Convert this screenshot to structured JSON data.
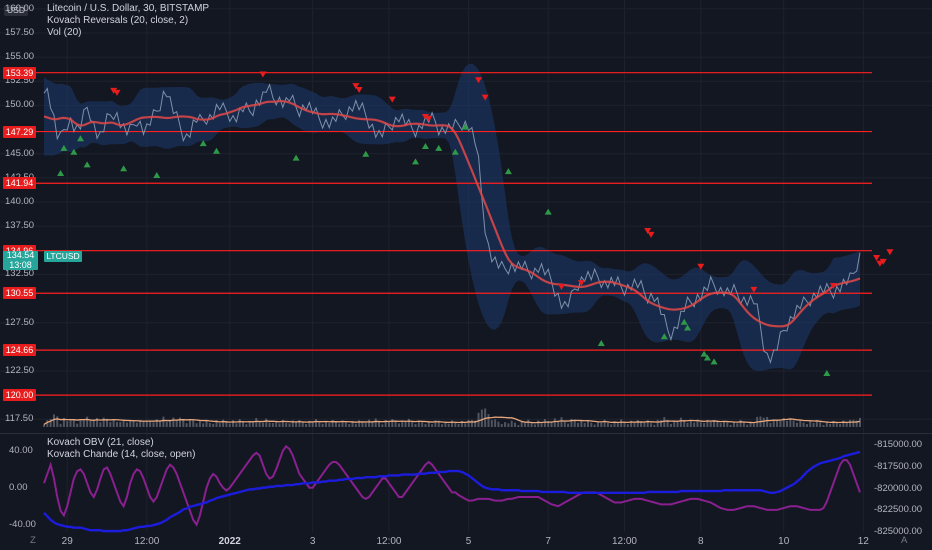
{
  "legend": {
    "main_title": "Litecoin / U.S. Dollar, 30, BITSTAMP",
    "indicator_kovach": "Kovach Reversals (20, close, 2)",
    "indicator_vol": "Vol (20)",
    "osc_obv": "Kovach OBV (21, close)",
    "osc_chande": "Kovach Chande (14, close, open)"
  },
  "currency_badge": "USD",
  "symbol_badge": "LTCUSD",
  "current_price": {
    "price": "134.54",
    "countdown": "13:08"
  },
  "price_tags": [
    {
      "label": "153.39",
      "value": 153.39
    },
    {
      "label": "147.29",
      "value": 147.29
    },
    {
      "label": "141.94",
      "value": 141.94
    },
    {
      "label": "134.96",
      "value": 134.96
    },
    {
      "label": "130.55",
      "value": 130.55
    },
    {
      "label": "124.66",
      "value": 124.66
    },
    {
      "label": "120.00",
      "value": 120.0
    }
  ],
  "price_axis_labels": [
    {
      "label": "160.00",
      "value": 160.0
    },
    {
      "label": "157.50",
      "value": 157.5
    },
    {
      "label": "155.00",
      "value": 155.0
    },
    {
      "label": "152.50",
      "value": 152.5
    },
    {
      "label": "150.00",
      "value": 150.0
    },
    {
      "label": "145.00",
      "value": 145.0
    },
    {
      "label": "142.50",
      "value": 142.5
    },
    {
      "label": "140.00",
      "value": 140.0
    },
    {
      "label": "137.50",
      "value": 137.5
    },
    {
      "label": "132.50",
      "value": 132.5
    },
    {
      "label": "127.50",
      "value": 127.5
    },
    {
      "label": "122.50",
      "value": 122.5
    },
    {
      "label": "117.50",
      "value": 117.5
    }
  ],
  "osc_left_labels": [
    {
      "label": "40.00",
      "value": 40
    },
    {
      "label": "0.00",
      "value": 0
    },
    {
      "label": "-40.00",
      "value": -40
    }
  ],
  "osc_right_labels": [
    {
      "label": "-815000.00",
      "value": -815000
    },
    {
      "label": "-817500.00",
      "value": -817500
    },
    {
      "label": "-820000.00",
      "value": -820000
    },
    {
      "label": "-822500.00",
      "value": -822500
    },
    {
      "label": "-825000.00",
      "value": -825000
    }
  ],
  "time_labels": [
    {
      "label": "29",
      "idx": 7,
      "bold": false
    },
    {
      "label": "12:00",
      "idx": 31,
      "bold": false
    },
    {
      "label": "2022",
      "idx": 56,
      "bold": true
    },
    {
      "label": "3",
      "idx": 81,
      "bold": false
    },
    {
      "label": "12:00",
      "idx": 104,
      "bold": false
    },
    {
      "label": "5",
      "idx": 128,
      "bold": false
    },
    {
      "label": "7",
      "idx": 152,
      "bold": false
    },
    {
      "label": "12:00",
      "idx": 175,
      "bold": false
    },
    {
      "label": "8",
      "idx": 198,
      "bold": false
    },
    {
      "label": "10",
      "idx": 223,
      "bold": false
    },
    {
      "label": "12",
      "idx": 247,
      "bold": false
    }
  ],
  "corner_labels": {
    "left": "Z",
    "right": "A"
  },
  "colors": {
    "background": "#131722",
    "level_line": "#ff1f1f",
    "band_fill": "#1e3a6e",
    "ma_line": "#e04848",
    "price_line": "#7e90a8",
    "sell_marker": "#e81c1c",
    "buy_marker": "#2e9a48",
    "volume": "#6b6f7a",
    "volume_ma": "#e8a77c",
    "obv_line": "#1c1cdc",
    "chande_line": "#8a2090",
    "accent": "#26a69a"
  },
  "chart_data": {
    "type": "line",
    "series": [
      {
        "name": "LTCUSD",
        "values": [
          152,
          151.5,
          150.2,
          148.5,
          146.8,
          146.5,
          147.5,
          148.2,
          148.5,
          147.8,
          147.5,
          147.8,
          148.8,
          149.8,
          149.2,
          148,
          147.1,
          146.8,
          147.5,
          148.4,
          149,
          149.3,
          149,
          148.2,
          147.6,
          147.2,
          147.3,
          148,
          148.6,
          148.1,
          147.5,
          147.6,
          148.2,
          148.8,
          149.4,
          150.2,
          151.2,
          151.4,
          150.4,
          149.4,
          148.6,
          147.9,
          147.1,
          146.8,
          147.2,
          148,
          148.5,
          148.3,
          148.5,
          148.8,
          148.8,
          149.1,
          149.6,
          149.8,
          149.5,
          149.4,
          149.1,
          148.7,
          148.8,
          149.2,
          149.6,
          149.5,
          149.4,
          149.7,
          150.3,
          150.5,
          150.9,
          151.6,
          151.4,
          150.8,
          150.8,
          150.6,
          150.3,
          150.3,
          150.7,
          150.3,
          149.8,
          149.6,
          149.8,
          150,
          149.8,
          149.4,
          149,
          148.6,
          148.4,
          148.3,
          148.2,
          148.3,
          148.6,
          148.8,
          149,
          149.3,
          149.6,
          149.9,
          150,
          149.8,
          149.5,
          149,
          148.4,
          147.8,
          147.2,
          146.9,
          147,
          147.4,
          147.8,
          148.2,
          148.5,
          148.8,
          148.6,
          148.2,
          147.8,
          147.6,
          147.5,
          147.7,
          148.1,
          148.4,
          148.5,
          148.5,
          148.3,
          147.7,
          147.5,
          147.6,
          147.6,
          147.7,
          147.8,
          148,
          148.2,
          148.1,
          147.9,
          147.2,
          146.2,
          144,
          140.5,
          137.5,
          135.4,
          134.3,
          133.8,
          133.4,
          133.1,
          133.1,
          133.3,
          133.4,
          133.3,
          133.3,
          133.3,
          133.1,
          132.8,
          132.8,
          132.9,
          133.2,
          133.1,
          132.7,
          132.3,
          131.8,
          131,
          130.3,
          129.5,
          129.2,
          129.4,
          130,
          131,
          131.6,
          132,
          132.3,
          132.3,
          132.2,
          132.3,
          132.2,
          131.9,
          131.6,
          131.6,
          131.7,
          131.6,
          131.5,
          131.2,
          131.1,
          131.2,
          131.4,
          131.5,
          131.4,
          131.1,
          130.6,
          130.3,
          130.3,
          130.2,
          129.6,
          128.6,
          127.6,
          126.8,
          126.5,
          126.8,
          127.4,
          128.2,
          128.9,
          129.4,
          129.6,
          129.9,
          130.2,
          130.3,
          130.7,
          131.1,
          131.5,
          131.4,
          131.2,
          130.9,
          130.8,
          130.6,
          130.7,
          130.7,
          130.5,
          130.2,
          129.9,
          129.8,
          129.8,
          129.7,
          128.7,
          127.1,
          125.3,
          124.1,
          123.9,
          124.2,
          124.9,
          125.8,
          126.7,
          127.4,
          127.9,
          128.4,
          128.8,
          129.2,
          129.4,
          129.7,
          130,
          130.3,
          130.6,
          130.8,
          130.8,
          130.8,
          130.8,
          130.8,
          131,
          131.2,
          131.5,
          131.7,
          131.9,
          132.6,
          133.6,
          134.5
        ]
      },
      {
        "name": "OBV",
        "values": [
          -822800,
          -823200,
          -823600,
          -823900,
          -824100,
          -824200,
          -824300,
          -824400,
          -824400,
          -824500,
          -824500,
          -824500,
          -824600,
          -824700,
          -824800,
          -824800,
          -824800,
          -824800,
          -824900,
          -824900,
          -824900,
          -824900,
          -824900,
          -824900,
          -824800,
          -824800,
          -824700,
          -824600,
          -824500,
          -824400,
          -824400,
          -824300,
          -824300,
          -824200,
          -824100,
          -824000,
          -823800,
          -823600,
          -823300,
          -823100,
          -822900,
          -822700,
          -822400,
          -822300,
          -822100,
          -822000,
          -821900,
          -821800,
          -821700,
          -821600,
          -821400,
          -821300,
          -821100,
          -821000,
          -820900,
          -820800,
          -820700,
          -820600,
          -820500,
          -820400,
          -820300,
          -820200,
          -820100,
          -820100,
          -820000,
          -820000,
          -819900,
          -819900,
          -819800,
          -819800,
          -819700,
          -819700,
          -819700,
          -819600,
          -819600,
          -819600,
          -819500,
          -819500,
          -819400,
          -819400,
          -819400,
          -819300,
          -819300,
          -819300,
          -819200,
          -819200,
          -819100,
          -819100,
          -819100,
          -819000,
          -819000,
          -818900,
          -818900,
          -818900,
          -818800,
          -818800,
          -818800,
          -818700,
          -818700,
          -818700,
          -818700,
          -818600,
          -818600,
          -818600,
          -818500,
          -818500,
          -818500,
          -818500,
          -818400,
          -818400,
          -818400,
          -818400,
          -818400,
          -818300,
          -818300,
          -818300,
          -818200,
          -818200,
          -818200,
          -818100,
          -818100,
          -818100,
          -818000,
          -818000,
          -818000,
          -818000,
          -818100,
          -818300,
          -818500,
          -818800,
          -819100,
          -819400,
          -819700,
          -819900,
          -820000,
          -820100,
          -820100,
          -820100,
          -820200,
          -820200,
          -820200,
          -820200,
          -820200,
          -820200,
          -820300,
          -820300,
          -820300,
          -820300,
          -820300,
          -820300,
          -820400,
          -820400,
          -820400,
          -820400,
          -820400,
          -820400,
          -820400,
          -820400,
          -820500,
          -820500,
          -820500,
          -820500,
          -820500,
          -820500,
          -820500,
          -820500,
          -820500,
          -820500,
          -820500,
          -820500,
          -820500,
          -820500,
          -820500,
          -820500,
          -820500,
          -820500,
          -820500,
          -820500,
          -820500,
          -820500,
          -820500,
          -820500,
          -820400,
          -820400,
          -820400,
          -820400,
          -820400,
          -820400,
          -820400,
          -820400,
          -820400,
          -820400,
          -820300,
          -820300,
          -820300,
          -820300,
          -820300,
          -820300,
          -820300,
          -820300,
          -820300,
          -820300,
          -820300,
          -820300,
          -820300,
          -820200,
          -820200,
          -820200,
          -820200,
          -820200,
          -820200,
          -820200,
          -820200,
          -820200,
          -820200,
          -820200,
          -820200,
          -820300,
          -820400,
          -820500,
          -820500,
          -820400,
          -820300,
          -820100,
          -819900,
          -819700,
          -819500,
          -819200,
          -818900,
          -818500,
          -818100,
          -817800,
          -817500,
          -817300,
          -817100,
          -817000,
          -816900,
          -816800,
          -816700,
          -816600,
          -816500,
          -816300,
          -816200,
          -816100,
          -816000,
          -815900,
          -815800,
          -815600,
          -815400,
          -815100,
          -814800
        ]
      },
      {
        "name": "Chande",
        "values": [
          5,
          15,
          25,
          10,
          -10,
          -25,
          -30,
          -20,
          -5,
          10,
          18,
          20,
          15,
          5,
          -5,
          -10,
          -2,
          10,
          20,
          22,
          15,
          5,
          -5,
          -15,
          -20,
          -10,
          5,
          15,
          20,
          18,
          10,
          0,
          -10,
          -15,
          -10,
          0,
          10,
          20,
          25,
          22,
          15,
          5,
          -5,
          -15,
          -25,
          -35,
          -40,
          -30,
          -15,
          0,
          10,
          15,
          12,
          5,
          0,
          -3,
          0,
          5,
          10,
          15,
          20,
          25,
          30,
          35,
          38,
          35,
          25,
          15,
          10,
          12,
          20,
          30,
          40,
          45,
          42,
          35,
          25,
          15,
          10,
          5,
          0,
          0,
          5,
          10,
          15,
          20,
          25,
          28,
          28,
          25,
          20,
          15,
          10,
          5,
          0,
          -5,
          -10,
          -12,
          -10,
          -5,
          0,
          5,
          10,
          10,
          5,
          0,
          -5,
          -10,
          -10,
          -5,
          0,
          5,
          10,
          15,
          20,
          25,
          28,
          25,
          20,
          15,
          10,
          5,
          0,
          -5,
          -5,
          -8,
          -10,
          -12,
          -14,
          -14,
          -13,
          -12,
          -12,
          -12,
          -12,
          -13,
          -14,
          -14,
          -14,
          -13,
          -12,
          -12,
          -11,
          -10,
          -10,
          -10,
          -10,
          -10,
          -10,
          -10,
          -12,
          -14,
          -16,
          -18,
          -19,
          -20,
          -18,
          -16,
          -14,
          -12,
          -10,
          -8,
          -6,
          -5,
          -5,
          -5,
          -5,
          -6,
          -8,
          -10,
          -12,
          -14,
          -16,
          -16,
          -16,
          -15,
          -14,
          -13,
          -12,
          -12,
          -12,
          -13,
          -14,
          -15,
          -16,
          -17,
          -18,
          -18,
          -18,
          -18,
          -17,
          -16,
          -15,
          -14,
          -13,
          -12,
          -12,
          -12,
          -13,
          -14,
          -15,
          -16,
          -18,
          -20,
          -22,
          -23,
          -24,
          -24,
          -24,
          -23,
          -22,
          -21,
          -20,
          -20,
          -20,
          -21,
          -22,
          -23,
          -24,
          -24,
          -24,
          -24,
          -23,
          -22,
          -21,
          -20,
          -20,
          -20,
          -21,
          -22,
          -23,
          -24,
          -24,
          -24,
          -24,
          -22,
          -15,
          -5,
          5,
          15,
          25,
          30,
          30,
          25,
          15,
          5,
          -5,
          -10,
          -12,
          -12,
          -11,
          -10,
          -10,
          -11,
          -12,
          -13,
          -14,
          -14,
          -14,
          -13,
          -13,
          -13
        ]
      }
    ],
    "xlabel": "",
    "ylabel": "",
    "ylim": [
      116.6,
      160.5
    ],
    "levels": [
      153.39,
      147.29,
      141.94,
      134.96,
      130.55,
      124.66,
      120.0
    ],
    "sell_markers": [
      [
        21,
        151.5
      ],
      [
        22,
        151.3
      ],
      [
        66,
        153.2
      ],
      [
        94,
        152.0
      ],
      [
        95,
        151.6
      ],
      [
        105,
        150.6
      ],
      [
        115,
        148.8
      ],
      [
        116,
        148.6
      ],
      [
        131,
        152.6
      ],
      [
        133,
        150.8
      ],
      [
        156,
        131.2
      ],
      [
        162,
        131.6
      ],
      [
        182,
        137.0
      ],
      [
        183,
        136.6
      ],
      [
        198,
        133.3
      ],
      [
        214,
        130.9
      ],
      [
        238,
        131.3
      ],
      [
        251,
        134.2
      ],
      [
        252,
        133.6
      ],
      [
        253,
        133.8
      ],
      [
        255,
        134.8
      ]
    ],
    "buy_markers": [
      [
        5,
        143.0
      ],
      [
        6,
        145.6
      ],
      [
        9,
        145.2
      ],
      [
        11,
        146.6
      ],
      [
        13,
        143.9
      ],
      [
        24,
        143.5
      ],
      [
        34,
        142.8
      ],
      [
        48,
        146.1
      ],
      [
        52,
        145.3
      ],
      [
        76,
        144.6
      ],
      [
        97,
        145.0
      ],
      [
        112,
        144.2
      ],
      [
        115,
        145.8
      ],
      [
        119,
        145.6
      ],
      [
        124,
        145.2
      ],
      [
        127,
        147.8
      ],
      [
        140,
        143.2
      ],
      [
        152,
        139.0
      ],
      [
        168,
        125.4
      ],
      [
        187,
        126.1
      ],
      [
        193,
        127.6
      ],
      [
        194,
        127.0
      ],
      [
        199,
        124.3
      ],
      [
        200,
        123.9
      ],
      [
        202,
        123.5
      ],
      [
        236,
        122.3
      ]
    ],
    "volume_ylim": [
      0,
      100
    ],
    "osc_ylim": [
      -48,
      54
    ],
    "obv_ylim": [
      -825000,
      -815000
    ]
  }
}
